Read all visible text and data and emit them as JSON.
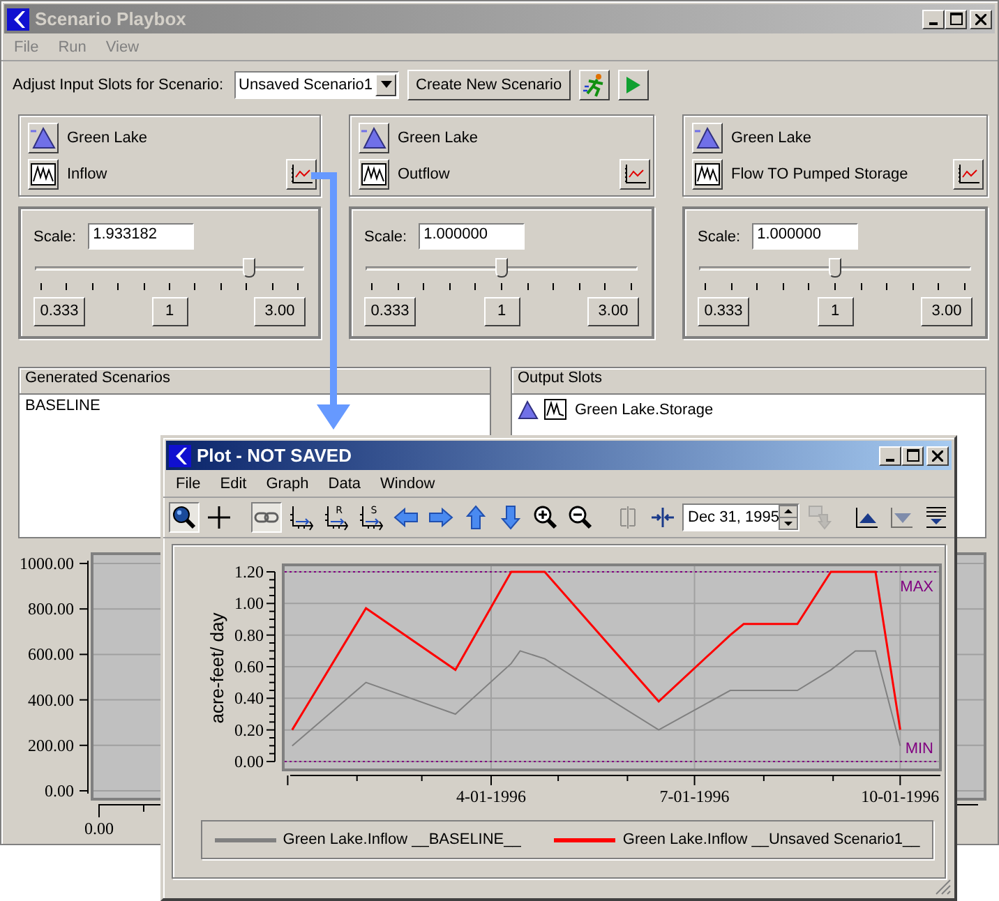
{
  "main_window": {
    "title": "Scenario Playbox",
    "menu": [
      "File",
      "Run",
      "View"
    ],
    "scenario_label": "Adjust Input Slots for Scenario:",
    "scenario_select": "Unsaved Scenario1",
    "create_button": "Create New Scenario",
    "input_slots": [
      {
        "object": "Green Lake",
        "slot": "Inflow",
        "scale_label": "Scale:",
        "scale": "1.933182",
        "level": 0.8,
        "buttons": [
          "0.333",
          "1",
          "3.00"
        ]
      },
      {
        "object": "Green Lake",
        "slot": "Outflow",
        "scale_label": "Scale:",
        "scale": "1.000000",
        "level": 0.5,
        "buttons": [
          "0.333",
          "1",
          "3.00"
        ]
      },
      {
        "object": "Green Lake",
        "slot": "Flow TO Pumped Storage",
        "scale_label": "Scale:",
        "scale": "1.000000",
        "level": 0.5,
        "buttons": [
          "0.333",
          "1",
          "3.00"
        ]
      }
    ],
    "generated_scenarios": {
      "title": "Generated Scenarios",
      "items": [
        {
          "label": "BASELINE",
          "selected": false
        }
      ]
    },
    "output_slots": {
      "title": "Output Slots",
      "items": [
        "Green Lake.Storage"
      ]
    },
    "background_plot": {
      "yticks": [
        "1000.00",
        "800.00",
        "600.00",
        "400.00",
        "200.00",
        "0.00"
      ],
      "xticks": [
        "0.00"
      ]
    }
  },
  "plot_window": {
    "title": "Plot - NOT SAVED",
    "menu": [
      "File",
      "Edit",
      "Graph",
      "Data",
      "Window"
    ],
    "tools": [
      {
        "kind": "magnifier",
        "selected": true,
        "disabled": false
      },
      {
        "kind": "crosshair",
        "selected": false,
        "disabled": false
      },
      {
        "kind": "separator"
      },
      {
        "kind": "link",
        "selected": true,
        "disabled": false
      },
      {
        "kind": "axes",
        "selected": false,
        "disabled": false
      },
      {
        "kind": "axes",
        "badge": "R",
        "selected": false,
        "disabled": false
      },
      {
        "kind": "axes",
        "badge": "S",
        "selected": false,
        "disabled": false
      },
      {
        "kind": "left",
        "selected": false,
        "disabled": false
      },
      {
        "kind": "right",
        "selected": false,
        "disabled": false
      },
      {
        "kind": "up",
        "selected": false,
        "disabled": false
      },
      {
        "kind": "down",
        "selected": false,
        "disabled": false
      },
      {
        "kind": "zoom-in",
        "selected": false,
        "disabled": false
      },
      {
        "kind": "zoom-out",
        "selected": false,
        "disabled": false
      },
      {
        "kind": "separator"
      },
      {
        "kind": "split",
        "selected": false,
        "disabled": true
      },
      {
        "kind": "compress",
        "selected": false,
        "disabled": false
      },
      {
        "kind": "date",
        "value": "Dec 31, 1995"
      },
      {
        "kind": "data-arrow",
        "selected": false,
        "disabled": true
      },
      {
        "kind": "separator"
      },
      {
        "kind": "raise",
        "selected": false,
        "disabled": false
      },
      {
        "kind": "lower",
        "selected": false,
        "disabled": true
      },
      {
        "kind": "list",
        "selected": false,
        "disabled": false
      }
    ],
    "chart_data": {
      "type": "line",
      "ylabel": "acre-feet/ day",
      "x": [
        "1996-01-03",
        "1996-02-05",
        "1996-03-16",
        "1996-04-10",
        "1996-04-14",
        "1996-04-25",
        "1996-06-15",
        "1996-07-17",
        "1996-07-23",
        "1996-08-16",
        "1996-08-31",
        "1996-09-11",
        "1996-09-20",
        "1996-10-01"
      ],
      "series": [
        {
          "name": "Green Lake.Inflow __BASELINE__",
          "color": "#808080",
          "values": [
            0.1,
            0.5,
            0.3,
            0.62,
            0.7,
            0.65,
            0.2,
            0.45,
            0.45,
            0.45,
            0.58,
            0.7,
            0.7,
            0.1
          ]
        },
        {
          "name": "Green Lake.Inflow __Unsaved Scenario1__",
          "color": "#ff0000",
          "values": [
            0.2,
            0.97,
            0.58,
            1.2,
            1.2,
            1.2,
            0.38,
            0.8,
            0.87,
            0.87,
            1.2,
            1.2,
            1.2,
            0.2
          ]
        }
      ],
      "xlim": [
        "1995-12-30",
        "1996-10-19"
      ],
      "ylim": [
        0,
        1.2
      ],
      "xticks": [
        {
          "value": "1996-04-01",
          "label": "4-01-1996"
        },
        {
          "value": "1996-07-01",
          "label": "7-01-1996"
        },
        {
          "value": "1996-10-01",
          "label": "10-01-1996"
        }
      ],
      "yticks": [
        {
          "value": 0,
          "label": "0.00"
        },
        {
          "value": 0.2,
          "label": "0.20"
        },
        {
          "value": 0.4,
          "label": "0.40"
        },
        {
          "value": 0.6,
          "label": "0.60"
        },
        {
          "value": 0.8,
          "label": "0.80"
        },
        {
          "value": 1.0,
          "label": "1.00"
        },
        {
          "value": 1.2,
          "label": "1.20"
        }
      ],
      "grid": true,
      "legend": "bottom",
      "annotations": [
        "MAX",
        "MIN"
      ]
    }
  }
}
